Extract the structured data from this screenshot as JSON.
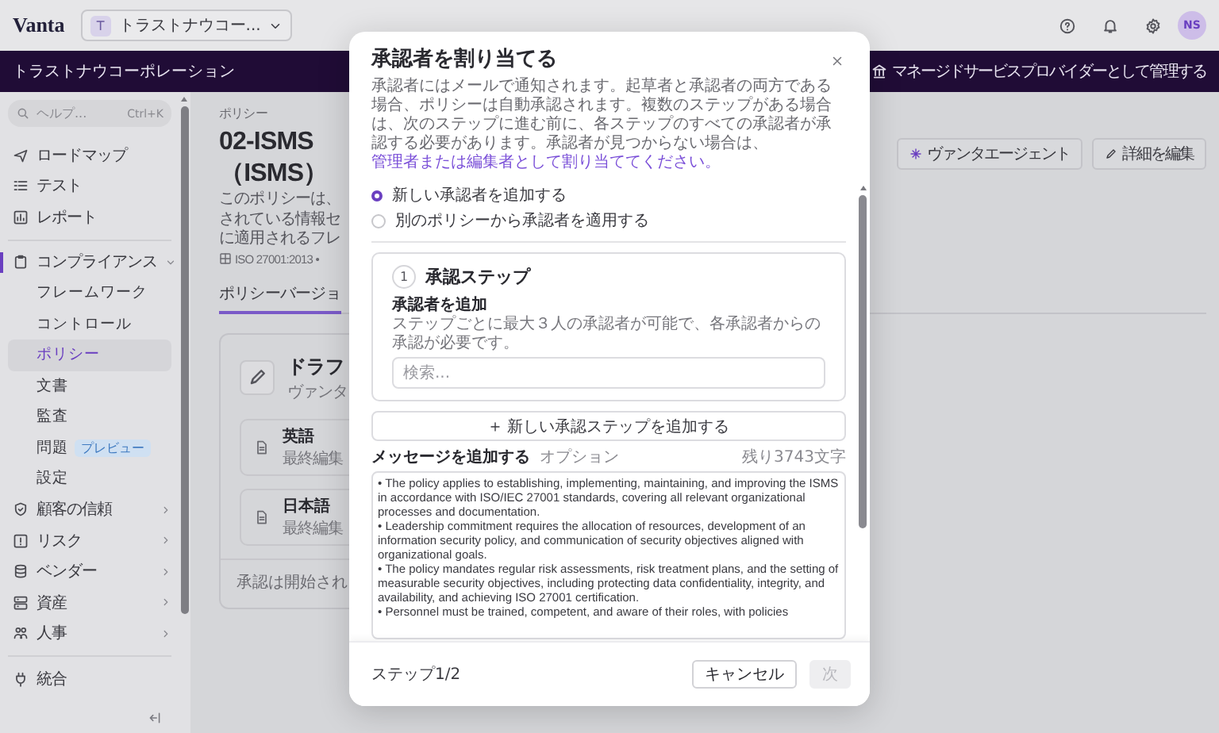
{
  "topbar": {
    "logo": "Vanta",
    "workspace": {
      "badge": "T",
      "label": "トラストナウコー..."
    },
    "avatar": "NS"
  },
  "org_bar": {
    "name": "トラストナウコーポレーション",
    "action": "マネージドサービスプロバイダーとして管理する"
  },
  "sidebar": {
    "search": {
      "placeholder": "ヘルプ...",
      "shortcut": "Ctrl+K"
    },
    "sections": [
      [
        {
          "label": "ロードマップ",
          "kind": "link"
        },
        {
          "label": "テスト",
          "kind": "link"
        },
        {
          "label": "レポート",
          "kind": "link"
        }
      ],
      [
        {
          "label": "コンプライアンス",
          "kind": "group",
          "expanded": true,
          "children": [
            {
              "label": "フレームワーク",
              "selected": false
            },
            {
              "label": "コントロール",
              "selected": false
            },
            {
              "label": "ポリシー",
              "selected": true
            },
            {
              "label": "文書",
              "selected": false
            },
            {
              "label": "監査",
              "selected": false
            },
            {
              "label": "問題",
              "selected": false,
              "badge": "プレビュー"
            },
            {
              "label": "設定",
              "selected": false
            }
          ]
        },
        {
          "label": "顧客の信頼",
          "kind": "group",
          "expanded": false
        },
        {
          "label": "リスク",
          "kind": "group",
          "expanded": false
        },
        {
          "label": "ベンダー",
          "kind": "group",
          "expanded": false
        },
        {
          "label": "資産",
          "kind": "group",
          "expanded": false
        },
        {
          "label": "人事",
          "kind": "group",
          "expanded": false
        }
      ],
      [
        {
          "label": "統合",
          "kind": "link"
        }
      ]
    ]
  },
  "policy": {
    "breadcrumb": "ポリシー",
    "title_lines": [
      "02-ISMS",
      "（ISMS）"
    ],
    "description_lines": [
      "このポリシーは、",
      "されている情報セ",
      "に適用されるフレ"
    ],
    "frameworks": "ISO 27001:2013 •",
    "buttons": [
      {
        "label": "ヴァンタエージェント",
        "kind": "agent"
      },
      {
        "label": "詳細を編集",
        "kind": "edit"
      }
    ],
    "tabs": [
      {
        "label": "ポリシーバージョ",
        "selected": true
      }
    ],
    "draft": {
      "title": "ドラフ",
      "subtitle": "ヴァンタ",
      "documents": [
        {
          "name": "英語",
          "meta": "最終編集"
        },
        {
          "name": "日本語",
          "meta": "最終編集"
        }
      ],
      "footer": "承認は開始され"
    }
  },
  "modal": {
    "title": "承認者を割り当てる",
    "description": "承認者にはメールで通知されます。起草者と承認者の両方である場合、ポリシーは自動承認されます。複数のステップがある場合は、次のステップに進む前に、各ステップのすべての承認者が承認する必要があります。承認者が見つからない場合は、",
    "link": "管理者または編集者として割り当ててください。",
    "options": [
      {
        "label": "新しい承認者を追加する",
        "selected": true
      },
      {
        "label": "別のポリシーから承認者を適用する",
        "selected": false
      }
    ],
    "steps": [
      {
        "number": "1",
        "title": "承認ステップ",
        "field_label": "承認者を追加",
        "hint": "ステップごとに最大３人の承認者が可能で、各承認者からの承認が必要です。",
        "search": {
          "placeholder": "検索..."
        }
      }
    ],
    "add_step": "新しい承認ステップを追加する",
    "message": {
      "label": "メッセージを追加する",
      "optional": "オプション",
      "remaining": "残り3743文字",
      "value": "• The policy applies to establishing, implementing, maintaining, and improving the ISMS in accordance with ISO/IEC 27001 standards, covering all relevant organizational processes and documentation.\n• Leadership commitment requires the allocation of resources, development of an information security policy, and communication of security objectives aligned with organizational goals.\n• The policy mandates regular risk assessments, risk treatment plans, and the setting of measurable security objectives, including protecting data confidentiality, integrity, and availability, and achieving ISO 27001 certification.\n• Personnel must be trained, competent, and aware of their roles, with policies"
    },
    "footer": {
      "step": "ステップ1/2",
      "buttons": [
        {
          "label": "キャンセル",
          "kind": "secondary",
          "disabled": false
        },
        {
          "label": "次",
          "kind": "primary",
          "disabled": true
        }
      ]
    }
  }
}
